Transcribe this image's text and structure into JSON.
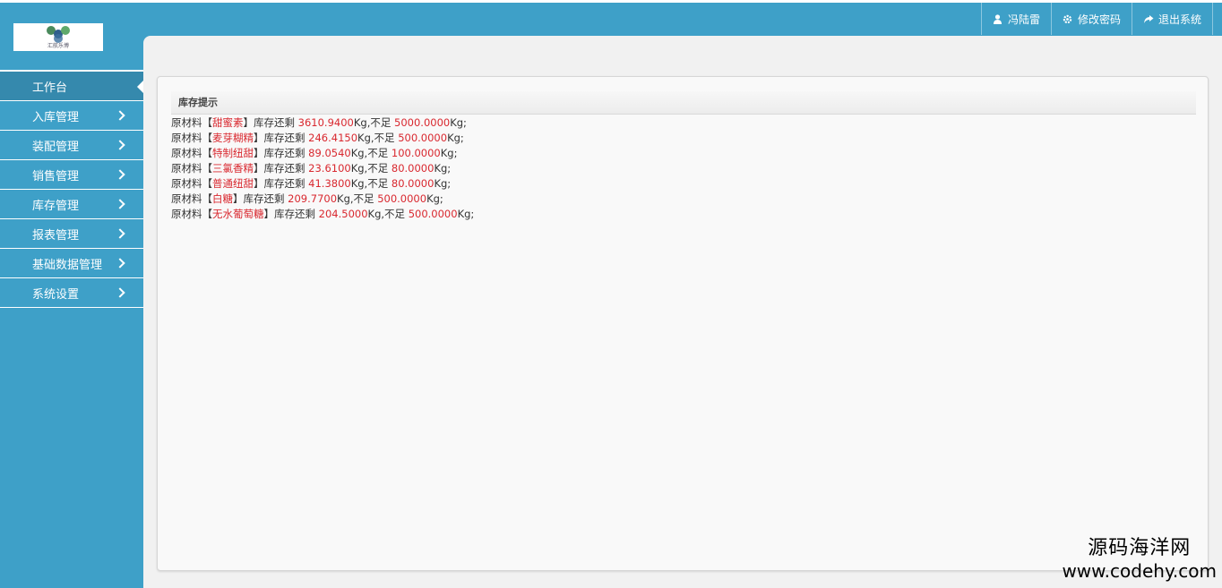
{
  "header": {
    "logo_caption": "汇航乐博",
    "user_label": "冯陆雷",
    "change_password_label": "修改密码",
    "logout_label": "退出系统"
  },
  "sidebar": {
    "items": [
      {
        "label": "工作台",
        "active": true
      },
      {
        "label": "入库管理"
      },
      {
        "label": "装配管理"
      },
      {
        "label": "销售管理"
      },
      {
        "label": "库存管理"
      },
      {
        "label": "报表管理"
      },
      {
        "label": "基础数据管理"
      },
      {
        "label": "系统设置"
      }
    ]
  },
  "panel": {
    "title": "库存提示",
    "rows": [
      {
        "prefix": "原材料",
        "open": "【",
        "name": "甜蜜素",
        "close": "】",
        "mid": "库存还剩 ",
        "remain": "3610.9400",
        "unit1": "Kg,不足 ",
        "min": "5000.0000",
        "unit2": "Kg;"
      },
      {
        "prefix": "原材料",
        "open": "【",
        "name": "麦芽糊精",
        "close": "】",
        "mid": "库存还剩 ",
        "remain": "246.4150",
        "unit1": "Kg,不足 ",
        "min": "500.0000",
        "unit2": "Kg;"
      },
      {
        "prefix": "原材料",
        "open": "【",
        "name": "特制纽甜",
        "close": "】",
        "mid": "库存还剩 ",
        "remain": "89.0540",
        "unit1": "Kg,不足 ",
        "min": "100.0000",
        "unit2": "Kg;"
      },
      {
        "prefix": "原材料",
        "open": "【",
        "name": "三氯香精",
        "close": "】",
        "mid": "库存还剩 ",
        "remain": "23.6100",
        "unit1": "Kg,不足 ",
        "min": "80.0000",
        "unit2": "Kg;"
      },
      {
        "prefix": "原材料",
        "open": "【",
        "name": "普通纽甜",
        "close": "】",
        "mid": "库存还剩 ",
        "remain": "41.3800",
        "unit1": "Kg,不足 ",
        "min": "80.0000",
        "unit2": "Kg;"
      },
      {
        "prefix": "原材料",
        "open": "【",
        "name": "白糖",
        "close": "】",
        "mid": "库存还剩 ",
        "remain": "209.7700",
        "unit1": "Kg,不足 ",
        "min": "500.0000",
        "unit2": "Kg;"
      },
      {
        "prefix": "原材料",
        "open": "【",
        "name": "无水葡萄糖",
        "close": "】",
        "mid": "库存还剩 ",
        "remain": "204.5000",
        "unit1": "Kg,不足 ",
        "min": "500.0000",
        "unit2": "Kg;"
      }
    ]
  },
  "watermark": {
    "cn": "源码海洋网",
    "url": "www.codehy.com"
  },
  "colors": {
    "brand": "#3ea0c8",
    "active_nav": "#3589ad",
    "alert_red": "#d9282f",
    "content_bg": "#f1f1f1"
  }
}
